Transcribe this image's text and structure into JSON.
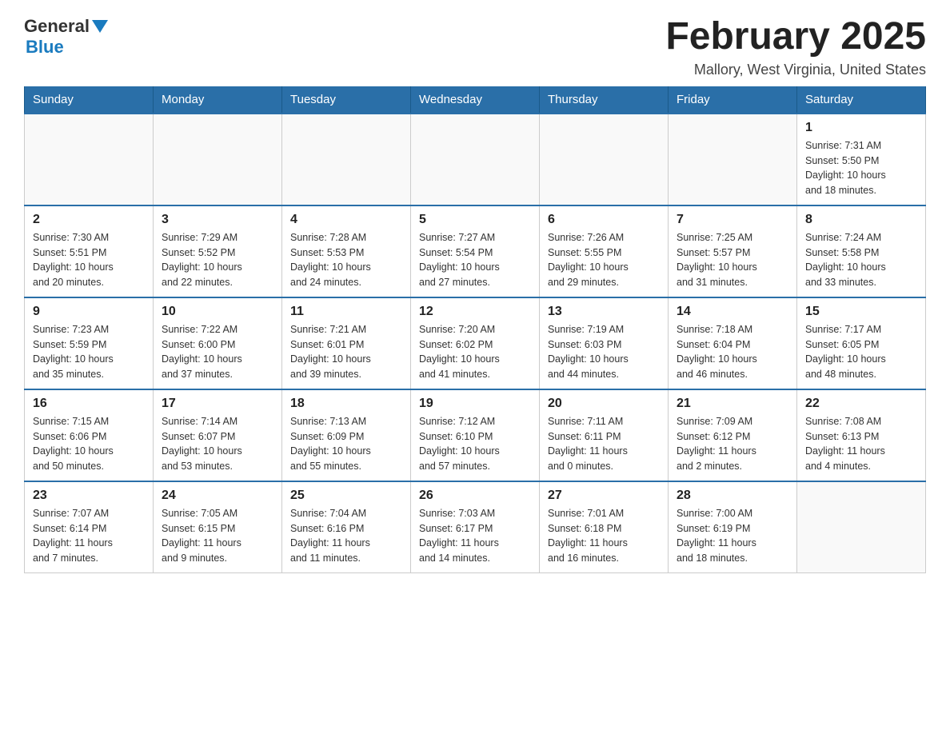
{
  "header": {
    "logo_general": "General",
    "logo_blue": "Blue",
    "month_title": "February 2025",
    "location": "Mallory, West Virginia, United States"
  },
  "days_of_week": [
    "Sunday",
    "Monday",
    "Tuesday",
    "Wednesday",
    "Thursday",
    "Friday",
    "Saturday"
  ],
  "weeks": [
    [
      {
        "day": "",
        "info": ""
      },
      {
        "day": "",
        "info": ""
      },
      {
        "day": "",
        "info": ""
      },
      {
        "day": "",
        "info": ""
      },
      {
        "day": "",
        "info": ""
      },
      {
        "day": "",
        "info": ""
      },
      {
        "day": "1",
        "info": "Sunrise: 7:31 AM\nSunset: 5:50 PM\nDaylight: 10 hours\nand 18 minutes."
      }
    ],
    [
      {
        "day": "2",
        "info": "Sunrise: 7:30 AM\nSunset: 5:51 PM\nDaylight: 10 hours\nand 20 minutes."
      },
      {
        "day": "3",
        "info": "Sunrise: 7:29 AM\nSunset: 5:52 PM\nDaylight: 10 hours\nand 22 minutes."
      },
      {
        "day": "4",
        "info": "Sunrise: 7:28 AM\nSunset: 5:53 PM\nDaylight: 10 hours\nand 24 minutes."
      },
      {
        "day": "5",
        "info": "Sunrise: 7:27 AM\nSunset: 5:54 PM\nDaylight: 10 hours\nand 27 minutes."
      },
      {
        "day": "6",
        "info": "Sunrise: 7:26 AM\nSunset: 5:55 PM\nDaylight: 10 hours\nand 29 minutes."
      },
      {
        "day": "7",
        "info": "Sunrise: 7:25 AM\nSunset: 5:57 PM\nDaylight: 10 hours\nand 31 minutes."
      },
      {
        "day": "8",
        "info": "Sunrise: 7:24 AM\nSunset: 5:58 PM\nDaylight: 10 hours\nand 33 minutes."
      }
    ],
    [
      {
        "day": "9",
        "info": "Sunrise: 7:23 AM\nSunset: 5:59 PM\nDaylight: 10 hours\nand 35 minutes."
      },
      {
        "day": "10",
        "info": "Sunrise: 7:22 AM\nSunset: 6:00 PM\nDaylight: 10 hours\nand 37 minutes."
      },
      {
        "day": "11",
        "info": "Sunrise: 7:21 AM\nSunset: 6:01 PM\nDaylight: 10 hours\nand 39 minutes."
      },
      {
        "day": "12",
        "info": "Sunrise: 7:20 AM\nSunset: 6:02 PM\nDaylight: 10 hours\nand 41 minutes."
      },
      {
        "day": "13",
        "info": "Sunrise: 7:19 AM\nSunset: 6:03 PM\nDaylight: 10 hours\nand 44 minutes."
      },
      {
        "day": "14",
        "info": "Sunrise: 7:18 AM\nSunset: 6:04 PM\nDaylight: 10 hours\nand 46 minutes."
      },
      {
        "day": "15",
        "info": "Sunrise: 7:17 AM\nSunset: 6:05 PM\nDaylight: 10 hours\nand 48 minutes."
      }
    ],
    [
      {
        "day": "16",
        "info": "Sunrise: 7:15 AM\nSunset: 6:06 PM\nDaylight: 10 hours\nand 50 minutes."
      },
      {
        "day": "17",
        "info": "Sunrise: 7:14 AM\nSunset: 6:07 PM\nDaylight: 10 hours\nand 53 minutes."
      },
      {
        "day": "18",
        "info": "Sunrise: 7:13 AM\nSunset: 6:09 PM\nDaylight: 10 hours\nand 55 minutes."
      },
      {
        "day": "19",
        "info": "Sunrise: 7:12 AM\nSunset: 6:10 PM\nDaylight: 10 hours\nand 57 minutes."
      },
      {
        "day": "20",
        "info": "Sunrise: 7:11 AM\nSunset: 6:11 PM\nDaylight: 11 hours\nand 0 minutes."
      },
      {
        "day": "21",
        "info": "Sunrise: 7:09 AM\nSunset: 6:12 PM\nDaylight: 11 hours\nand 2 minutes."
      },
      {
        "day": "22",
        "info": "Sunrise: 7:08 AM\nSunset: 6:13 PM\nDaylight: 11 hours\nand 4 minutes."
      }
    ],
    [
      {
        "day": "23",
        "info": "Sunrise: 7:07 AM\nSunset: 6:14 PM\nDaylight: 11 hours\nand 7 minutes."
      },
      {
        "day": "24",
        "info": "Sunrise: 7:05 AM\nSunset: 6:15 PM\nDaylight: 11 hours\nand 9 minutes."
      },
      {
        "day": "25",
        "info": "Sunrise: 7:04 AM\nSunset: 6:16 PM\nDaylight: 11 hours\nand 11 minutes."
      },
      {
        "day": "26",
        "info": "Sunrise: 7:03 AM\nSunset: 6:17 PM\nDaylight: 11 hours\nand 14 minutes."
      },
      {
        "day": "27",
        "info": "Sunrise: 7:01 AM\nSunset: 6:18 PM\nDaylight: 11 hours\nand 16 minutes."
      },
      {
        "day": "28",
        "info": "Sunrise: 7:00 AM\nSunset: 6:19 PM\nDaylight: 11 hours\nand 18 minutes."
      },
      {
        "day": "",
        "info": ""
      }
    ]
  ]
}
